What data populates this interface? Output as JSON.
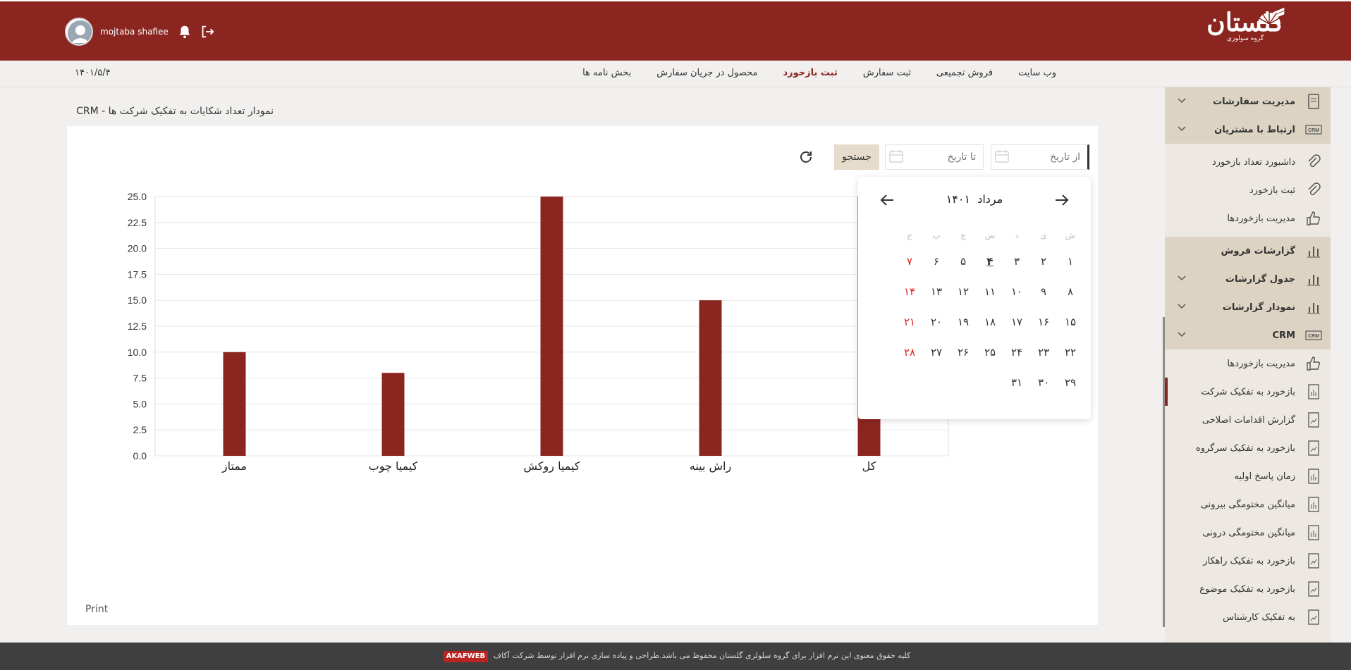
{
  "header": {
    "logo_text": "گلستان",
    "logo_sub": "گروه سولوزی",
    "user_name": "mojtaba shafiee"
  },
  "topnav": {
    "date": "۱۴۰۱/۵/۴",
    "links": [
      "وب سایت",
      "فروش تجمیعی",
      "ثبت سفارش",
      "ثبت بازخورد",
      "محصول در جریان سفارش",
      "بخش نامه ها"
    ],
    "active_index": 3
  },
  "page": {
    "title": "نمودار تعداد شکایات به تفکیک شرکت ها - CRM",
    "from_placeholder": "از تاریخ",
    "to_placeholder": "تا تاریخ",
    "search_label": "جستجو",
    "print_label": "Print"
  },
  "datepicker": {
    "month": "مرداد",
    "year": "۱۴۰۱",
    "weekdays": [
      "ش",
      "ی",
      "د",
      "س",
      "چ",
      "پ",
      "ج"
    ],
    "weeks": [
      [
        "۱",
        "۲",
        "۳",
        "۴",
        "۵",
        "۶",
        "۷"
      ],
      [
        "۸",
        "۹",
        "۱۰",
        "۱۱",
        "۱۲",
        "۱۳",
        "۱۴"
      ],
      [
        "۱۵",
        "۱۶",
        "۱۷",
        "۱۸",
        "۱۹",
        "۲۰",
        "۲۱"
      ],
      [
        "۲۲",
        "۲۳",
        "۲۴",
        "۲۵",
        "۲۶",
        "۲۷",
        "۲۸"
      ],
      [
        "۲۹",
        "۳۰",
        "۳۱",
        "",
        "",
        "",
        ""
      ]
    ],
    "today": "۴",
    "holiday_color": "#e02020"
  },
  "chart_data": {
    "type": "bar",
    "categories": [
      "ممتاز",
      "کیمیا چوب",
      "کیمیا روکش",
      "راش بینه",
      "کل"
    ],
    "values": [
      10,
      8,
      25,
      15,
      66
    ],
    "ylim": [
      0,
      25
    ],
    "yticks": [
      "0.0",
      "2.5",
      "5.0",
      "7.5",
      "10.0",
      "12.5",
      "15.0",
      "17.5",
      "20.0",
      "22.5",
      "25.0"
    ],
    "bar_color": "#8b2520",
    "grid": true,
    "title": "",
    "xlabel": "",
    "ylabel": ""
  },
  "sidebar": {
    "items": [
      {
        "label": "مدیریت سفارشات",
        "group": true,
        "chevron": true,
        "icon": "document-icon"
      },
      {
        "label": "ارتباط با مشتریان",
        "group": true,
        "chevron": true,
        "icon": "crm-icon"
      },
      {
        "sep": true
      },
      {
        "label": "داشبورد تعداد بازخورد",
        "group": false,
        "icon": "paperclip-icon"
      },
      {
        "label": "ثبت بازخورد",
        "group": false,
        "icon": "paperclip-icon"
      },
      {
        "label": "مدیریت بازخوردها",
        "group": false,
        "icon": "thumbs-up-icon"
      },
      {
        "sep": true
      },
      {
        "label": "گزارشات فروش",
        "group": true,
        "chevron": false,
        "icon": "bar-chart-icon"
      },
      {
        "label": "جدول گزارشات",
        "group": true,
        "chevron": true,
        "icon": "bar-chart-icon"
      },
      {
        "label": "نمودار گزارشات",
        "group": true,
        "chevron": true,
        "icon": "bar-chart-icon"
      },
      {
        "label": "CRM",
        "group": true,
        "chevron": true,
        "icon": "crm-icon"
      },
      {
        "label": "مدیریت بازخوردها",
        "group": false,
        "icon": "thumbs-up-icon"
      },
      {
        "label": "بازخورد به تفکیک شرکت",
        "group": false,
        "icon": "report-icon",
        "active": true
      },
      {
        "label": "گزارش اقدامات اصلاحی",
        "group": false,
        "icon": "line-report-icon"
      },
      {
        "label": "بازخورد به تفکیک سرگروه",
        "group": false,
        "icon": "line-report-icon"
      },
      {
        "label": "زمان پاسخ اولیه",
        "group": false,
        "icon": "report-icon"
      },
      {
        "label": "میانگین مختومگی بیرونی",
        "group": false,
        "icon": "report-icon"
      },
      {
        "label": "میانگین مختومگی درونی",
        "group": false,
        "icon": "report-icon"
      },
      {
        "label": "بازخورد به تفکیک راهکار",
        "group": false,
        "icon": "line-report-icon"
      },
      {
        "label": "بازخورد به تفکیک موضوع",
        "group": false,
        "icon": "line-report-icon"
      },
      {
        "label": "به تفکیک کارشناس",
        "group": false,
        "icon": "line-report-icon"
      }
    ]
  },
  "footer": {
    "text": "کلیه حقوق معنوی این نرم افزار برای گروه سلولزی گلستان محفوظ می باشد.طراحی و پیاده سازی نرم افزار توسط شرکت آکاف",
    "brand": "AKAFWEB"
  }
}
